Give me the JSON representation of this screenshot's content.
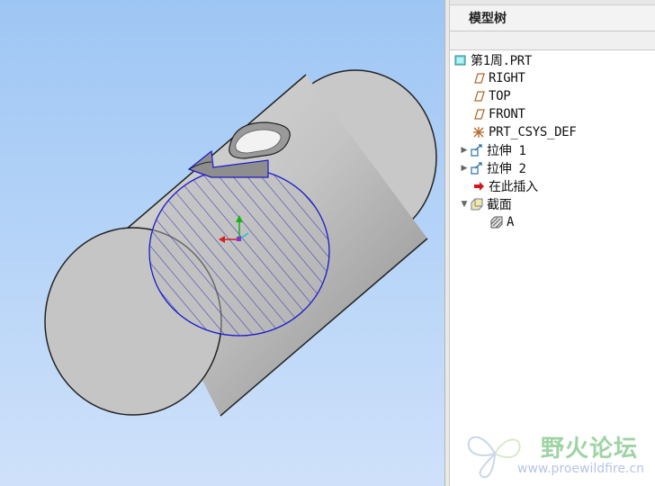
{
  "model_tree": {
    "title": "模型树",
    "items": [
      {
        "label": "第1周.PRT",
        "icon": "part-icon",
        "expander": ""
      },
      {
        "label": "RIGHT",
        "icon": "datum-plane-icon",
        "expander": ""
      },
      {
        "label": "TOP",
        "icon": "datum-plane-icon",
        "expander": ""
      },
      {
        "label": "FRONT",
        "icon": "datum-plane-icon",
        "expander": ""
      },
      {
        "label": "PRT_CSYS_DEF",
        "icon": "coordinate-system-icon",
        "expander": ""
      },
      {
        "label": "拉伸 1",
        "icon": "extrude-icon",
        "expander": "▶"
      },
      {
        "label": "拉伸 2",
        "icon": "extrude-icon",
        "expander": "▶"
      },
      {
        "label": "在此插入",
        "icon": "insert-here-arrow-icon",
        "expander": ""
      },
      {
        "label": "截面",
        "icon": "section-folder-icon",
        "expander": "▼"
      },
      {
        "label": "A",
        "icon": "cross-section-icon",
        "expander": ""
      }
    ]
  },
  "watermark": {
    "title": "野火论坛",
    "url": "www.proewildfire.cn"
  },
  "colors": {
    "viewport_top": "#9ec6f4",
    "viewport_bottom": "#cfe1fa",
    "section_outline": "#1a1acc",
    "part_gray": "#bdbdbd"
  }
}
